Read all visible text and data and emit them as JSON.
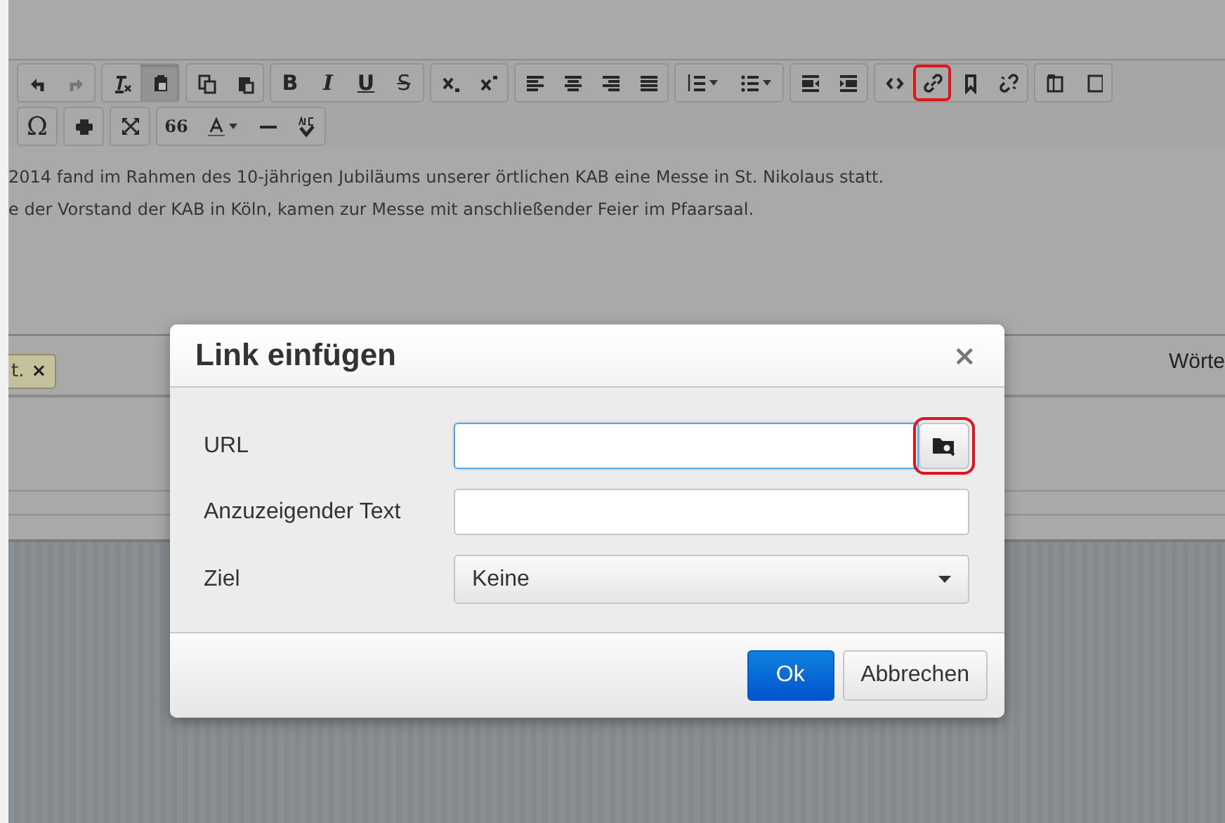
{
  "toolbar": {
    "rows": [
      [
        [
          {
            "kind": "undo",
            "pressed": false,
            "outlined": false
          },
          {
            "kind": "redo",
            "pressed": false,
            "outlined": false
          }
        ],
        [
          {
            "kind": "clear-format",
            "pressed": false,
            "outlined": false
          },
          {
            "kind": "paste-text",
            "pressed": true,
            "outlined": false
          }
        ],
        [
          {
            "kind": "copy",
            "pressed": false,
            "outlined": false
          },
          {
            "kind": "paste",
            "pressed": false,
            "outlined": false
          }
        ],
        [
          {
            "kind": "bold",
            "glyph": "B",
            "pressed": false,
            "outlined": false
          },
          {
            "kind": "italic",
            "glyph": "I",
            "pressed": false,
            "outlined": false
          },
          {
            "kind": "underline",
            "glyph": "U",
            "pressed": false,
            "outlined": false
          },
          {
            "kind": "strike",
            "glyph": "S",
            "pressed": false,
            "outlined": false
          }
        ],
        [
          {
            "kind": "subscript",
            "pressed": false,
            "outlined": false
          },
          {
            "kind": "superscript",
            "pressed": false,
            "outlined": false
          }
        ],
        [
          {
            "kind": "align-left",
            "pressed": false,
            "outlined": false
          },
          {
            "kind": "align-center",
            "pressed": false,
            "outlined": false
          },
          {
            "kind": "align-right",
            "pressed": false,
            "outlined": false
          },
          {
            "kind": "justify",
            "pressed": false,
            "outlined": false
          }
        ],
        [
          {
            "kind": "numbered-list",
            "pressed": false,
            "outlined": false
          },
          {
            "kind": "bullet-list",
            "pressed": false,
            "outlined": false
          }
        ],
        [
          {
            "kind": "outdent",
            "pressed": false,
            "outlined": false
          },
          {
            "kind": "indent",
            "pressed": false,
            "outlined": false
          }
        ],
        [
          {
            "kind": "code",
            "pressed": false,
            "outlined": false
          },
          {
            "kind": "link",
            "pressed": false,
            "outlined": true
          },
          {
            "kind": "bookmark",
            "pressed": false,
            "outlined": false
          },
          {
            "kind": "unlink",
            "pressed": false,
            "outlined": false
          }
        ],
        [
          {
            "kind": "template",
            "pressed": false,
            "outlined": false
          },
          {
            "kind": "cut-off",
            "pressed": false,
            "outlined": false
          }
        ]
      ],
      [
        [
          {
            "kind": "omega",
            "glyph": "Ω",
            "pressed": false,
            "outlined": false
          }
        ],
        [
          {
            "kind": "print",
            "pressed": false,
            "outlined": false
          }
        ],
        [
          {
            "kind": "fullscreen",
            "pressed": false,
            "outlined": false
          }
        ],
        [
          {
            "kind": "quote",
            "glyph": "66",
            "pressed": false,
            "outlined": false
          },
          {
            "kind": "text-color",
            "pressed": false,
            "outlined": false
          },
          {
            "kind": "horizontal-line",
            "pressed": false,
            "outlined": false
          },
          {
            "kind": "spellcheck",
            "pressed": false,
            "outlined": false
          }
        ]
      ]
    ]
  },
  "content": {
    "lines": [
      "2014 fand im Rahmen des 10-jährigen Jubiläums unserer örtlichen KAB eine Messe in St. Nikolaus statt.",
      "e der Vorstand der KAB in Köln, kamen zur Messe mit anschließender Feier im Pfaarsaal."
    ]
  },
  "tooltip": {
    "text": "t.",
    "close": "×"
  },
  "status_bar": {
    "word_count": "Wörte"
  },
  "dialog": {
    "title": "Link einfügen",
    "close": "×",
    "fields": [
      {
        "kind": "url",
        "label": "URL",
        "focused": true,
        "browse_outlined": true
      },
      {
        "kind": "text",
        "label": "Anzuzeigender Text",
        "focused": false
      },
      {
        "kind": "select",
        "label": "Ziel",
        "value": "Keine",
        "focused": false
      }
    ],
    "buttons": [
      {
        "label": "Ok",
        "primary": true
      },
      {
        "label": "Abbrechen",
        "primary": false
      }
    ]
  }
}
